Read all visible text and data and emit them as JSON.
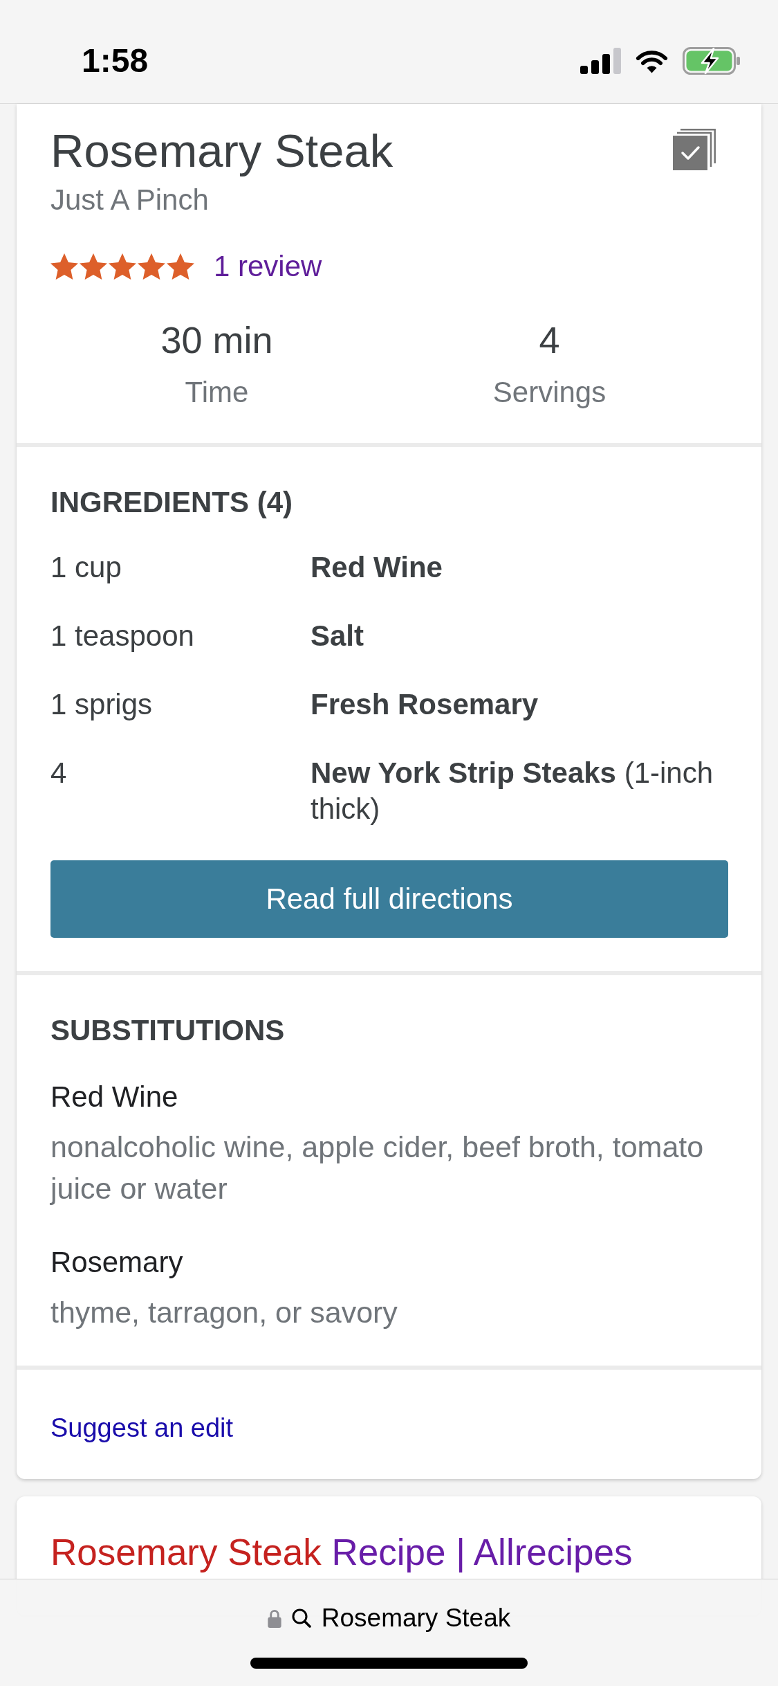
{
  "status_bar": {
    "time": "1:58"
  },
  "recipe": {
    "title": "Rosemary Steak",
    "source": "Just A Pinch",
    "rating": {
      "stars": 5,
      "reviews": "1 review"
    },
    "stats": [
      {
        "value": "30 min",
        "label": "Time"
      },
      {
        "value": "4",
        "label": "Servings"
      }
    ]
  },
  "ingredients": {
    "heading": "INGREDIENTS (4)",
    "items": [
      {
        "amount": "1 cup",
        "name": "Red Wine"
      },
      {
        "amount": "1 teaspoon",
        "name": "Salt"
      },
      {
        "amount": "1 sprigs",
        "name": "Fresh Rosemary"
      },
      {
        "amount": "4",
        "name": "New York Strip Steaks",
        "note": "(1-inch thick)"
      }
    ],
    "button": "Read full directions"
  },
  "substitutions": {
    "heading": "SUBSTITUTIONS",
    "items": [
      {
        "ingredient": "Red Wine",
        "options": "nonalcoholic wine, apple cider, beef broth, tomato juice or water"
      },
      {
        "ingredient": "Rosemary",
        "options": "thyme, tarragon, or savory"
      }
    ]
  },
  "suggest_edit": "Suggest an edit",
  "search_result": {
    "title_parts": [
      {
        "text": "Rosemary Steak",
        "highlighted": true
      },
      {
        "text": "Recipe | Allrecipes",
        "highlighted": false
      }
    ]
  },
  "address_bar": {
    "query": "Rosemary Steak",
    "secure": true
  }
}
